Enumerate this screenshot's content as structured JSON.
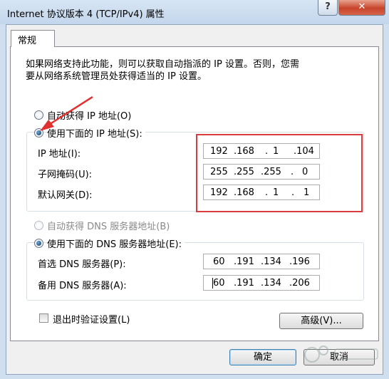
{
  "window": {
    "title": "Internet 协议版本 4 (TCP/IPv4) 属性",
    "help_label": "?",
    "close_label": "✕"
  },
  "tab": {
    "label": "常规"
  },
  "description": "如果网络支持此功能，则可以获取自动指派的 IP 设置。否则，您需\n要从网络系统管理员处获得适当的 IP 设置。",
  "ip": {
    "auto_label": "自动获得 IP 地址(O)",
    "manual_label": "使用下面的 IP 地址(S):",
    "fields": [
      {
        "label": "IP 地址(I):",
        "octets": [
          "192",
          ".168",
          ".",
          "1",
          ".104"
        ]
      },
      {
        "label": "子网掩码(U):",
        "octets": [
          "255",
          ".255",
          ".255",
          ".",
          "0"
        ]
      },
      {
        "label": "默认网关(D):",
        "octets": [
          "192",
          ".168",
          ".",
          "1",
          ".",
          "1"
        ]
      }
    ]
  },
  "dns": {
    "auto_label": "自动获得 DNS 服务器地址(B)",
    "manual_label": "使用下面的 DNS 服务器地址(E):",
    "fields": [
      {
        "label": "首选 DNS 服务器(P):",
        "octets": [
          "60",
          ".191",
          ".134",
          ".196"
        ]
      },
      {
        "label": "备用 DNS 服务器(A):",
        "octets": [
          "60",
          ".191",
          ".134",
          ".206"
        ]
      }
    ]
  },
  "validate_label": "退出时验证设置(L)",
  "buttons": {
    "advanced": "高级(V)...",
    "ok": "确定",
    "cancel": "取消"
  },
  "colors": {
    "highlight": "#d93d3d",
    "selection": "#3c7fb1"
  }
}
